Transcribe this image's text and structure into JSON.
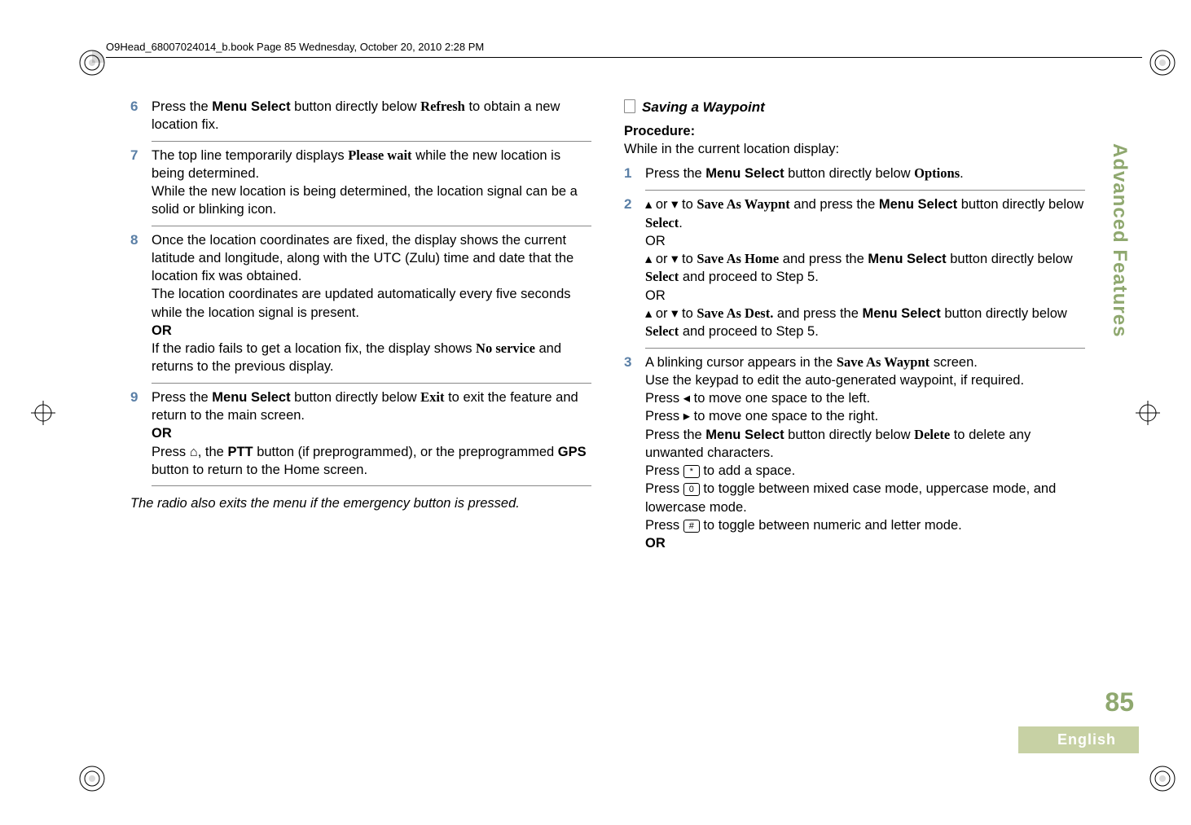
{
  "header": {
    "running": "O9Head_68007024014_b.book  Page 85  Wednesday, October 20, 2010  2:28 PM"
  },
  "left": {
    "s6": {
      "num": "6",
      "t1a": "Press the ",
      "t1b": "Menu Select",
      "t1c": " button directly below ",
      "t1d": "Refresh",
      "t1e": " to obtain a new location fix."
    },
    "s7": {
      "num": "7",
      "t1a": "The top line temporarily displays ",
      "t1b": "Please wait",
      "t1c": " while the new location is being determined.",
      "t2": "While the new location is being determined, the location signal can be a solid or blinking icon."
    },
    "s8": {
      "num": "8",
      "t1": "Once the location coordinates are fixed, the display shows the current latitude and longitude, along with the UTC (Zulu) time and date that the location fix was obtained.",
      "t2": "The location coordinates are updated automatically every five seconds while the location signal is present.",
      "or": "OR",
      "t3a": "If the radio fails to get a location fix, the display shows ",
      "t3b": "No service",
      "t3c": " and returns to the previous display."
    },
    "s9": {
      "num": "9",
      "t1a": "Press the ",
      "t1b": "Menu Select",
      "t1c": " button directly below ",
      "t1d": "Exit",
      "t1e": " to exit the feature and return to the main screen.",
      "or": "OR",
      "t2a": "Press ",
      "t2home": "⌂",
      "t2b": ", the ",
      "t2c": "PTT",
      "t2d": " button (if preprogrammed), or the preprogrammed ",
      "t2e": "GPS",
      "t2f": " button to return to the Home screen."
    },
    "note": "The radio also exits the menu if the emergency button is pressed."
  },
  "right": {
    "title": "Saving a Waypoint",
    "proc": "Procedure:",
    "intro": "While in the current location display:",
    "s1": {
      "num": "1",
      "a": "Press the ",
      "b": "Menu Select",
      "c": " button directly below ",
      "d": "Options",
      "e": "."
    },
    "s2": {
      "num": "2",
      "up": "▴",
      "or_word": " or ",
      "down": "▾",
      "to": " to ",
      "opt1": "Save As Waypnt",
      "and": " and press the ",
      "ms": "Menu Select",
      "btn": " button directly below ",
      "sel": "Select",
      "dot": ".",
      "OR": "OR",
      "opt2": "Save As Home",
      "proceed": " and proceed to Step 5.",
      "opt3": "Save As Dest.",
      "btn2": " button directly below "
    },
    "s3": {
      "num": "3",
      "l1a": "A blinking cursor appears in the ",
      "l1b": "Save As Waypnt",
      "l1c": " screen.",
      "l2": "Use the keypad to edit the auto-generated waypoint, if required.",
      "l3a": "Press ",
      "left": "◂",
      "l3b": " to move one space to the left.",
      "right_arr": "▸",
      "l4b": " to move one space to the right.",
      "l5a": "Press the ",
      "l5b": "Menu Select",
      "l5c": " button directly below ",
      "l5d": "Delete",
      "l5e": " to delete any unwanted characters.",
      "keystar": "*",
      "l6b": " to add a space.",
      "key0": "0",
      "l7b": " to toggle between mixed case mode, uppercase mode, and lowercase mode.",
      "keyhash": "#",
      "l8b": " to toggle between numeric and letter mode.",
      "OR": "OR"
    }
  },
  "side": {
    "tab": "Advanced Features",
    "page": "85",
    "lang": "English"
  }
}
